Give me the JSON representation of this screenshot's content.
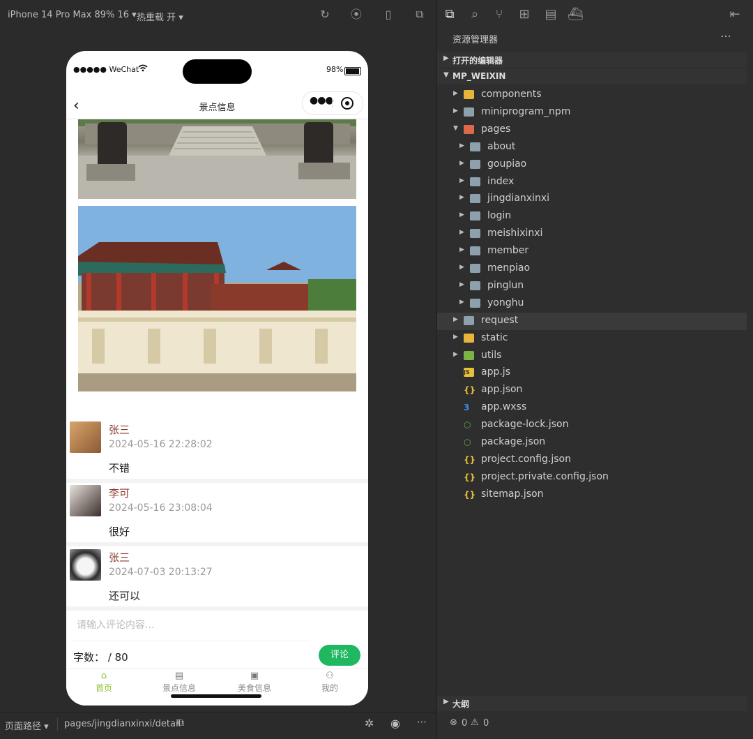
{
  "toolbar": {
    "device_label": "iPhone 14 Pro Max 89% 16",
    "hot_reload_label": "热重载 开"
  },
  "phone": {
    "carrier": "●●●●● WeChat",
    "battery": "98%",
    "nav_title": "景点信息",
    "comments": [
      {
        "name": "张三",
        "time": "2024-05-16 22:28:02",
        "text": "不错"
      },
      {
        "name": "李可",
        "time": "2024-05-16 23:08:04",
        "text": "很好"
      },
      {
        "name": "张三",
        "time": "2024-07-03 20:13:27",
        "text": "还可以"
      }
    ],
    "input_placeholder": "请输入评论内容...",
    "count_label": "字数：  / 80",
    "submit_label": "评论",
    "tabs": [
      "首页",
      "景点信息",
      "美食信息",
      "我的"
    ]
  },
  "bottom_bar": {
    "path_label": "页面路径",
    "path_value": "pages/jingdianxinxi/detail"
  },
  "explorer": {
    "title": "资源管理器",
    "open_editors": "打开的编辑器",
    "root": "MP_WEIXIN",
    "tree": [
      {
        "name": "components",
        "depth": 1,
        "kind": "folder-special",
        "expanded": false
      },
      {
        "name": "miniprogram_npm",
        "depth": 1,
        "kind": "folder",
        "expanded": false
      },
      {
        "name": "pages",
        "depth": 1,
        "kind": "folder-red",
        "expanded": true
      },
      {
        "name": "about",
        "depth": 2,
        "kind": "folder",
        "expanded": false
      },
      {
        "name": "goupiao",
        "depth": 2,
        "kind": "folder",
        "expanded": false
      },
      {
        "name": "index",
        "depth": 2,
        "kind": "folder",
        "expanded": false
      },
      {
        "name": "jingdianxinxi",
        "depth": 2,
        "kind": "folder",
        "expanded": false
      },
      {
        "name": "login",
        "depth": 2,
        "kind": "folder",
        "expanded": false
      },
      {
        "name": "meishixinxi",
        "depth": 2,
        "kind": "folder",
        "expanded": false
      },
      {
        "name": "member",
        "depth": 2,
        "kind": "folder",
        "expanded": false
      },
      {
        "name": "menpiao",
        "depth": 2,
        "kind": "folder",
        "expanded": false
      },
      {
        "name": "pinglun",
        "depth": 2,
        "kind": "folder",
        "expanded": false
      },
      {
        "name": "yonghu",
        "depth": 2,
        "kind": "folder",
        "expanded": false
      },
      {
        "name": "request",
        "depth": 1,
        "kind": "folder",
        "expanded": false,
        "selected": true
      },
      {
        "name": "static",
        "depth": 1,
        "kind": "folder-yellow",
        "expanded": false
      },
      {
        "name": "utils",
        "depth": 1,
        "kind": "folder-green",
        "expanded": false
      },
      {
        "name": "app.js",
        "depth": 1,
        "kind": "file-js"
      },
      {
        "name": "app.json",
        "depth": 1,
        "kind": "file-json"
      },
      {
        "name": "app.wxss",
        "depth": 1,
        "kind": "file-css"
      },
      {
        "name": "package-lock.json",
        "depth": 1,
        "kind": "file-node"
      },
      {
        "name": "package.json",
        "depth": 1,
        "kind": "file-node"
      },
      {
        "name": "project.config.json",
        "depth": 1,
        "kind": "file-json"
      },
      {
        "name": "project.private.config.json",
        "depth": 1,
        "kind": "file-json"
      },
      {
        "name": "sitemap.json",
        "depth": 1,
        "kind": "file-json"
      }
    ],
    "outline": "大纲",
    "errors": "0",
    "warnings": "0"
  },
  "colors": {
    "accent_green": "#1fb861",
    "comment_name": "#8a3a2a",
    "folder_gray": "#8fa0ad",
    "folder_red": "#e0684a",
    "folder_yellow": "#e8b33a",
    "folder_green": "#7cb342",
    "json_yellow": "#e8c03a",
    "css_blue": "#3a8ee8",
    "node_green": "#6aa84f"
  }
}
